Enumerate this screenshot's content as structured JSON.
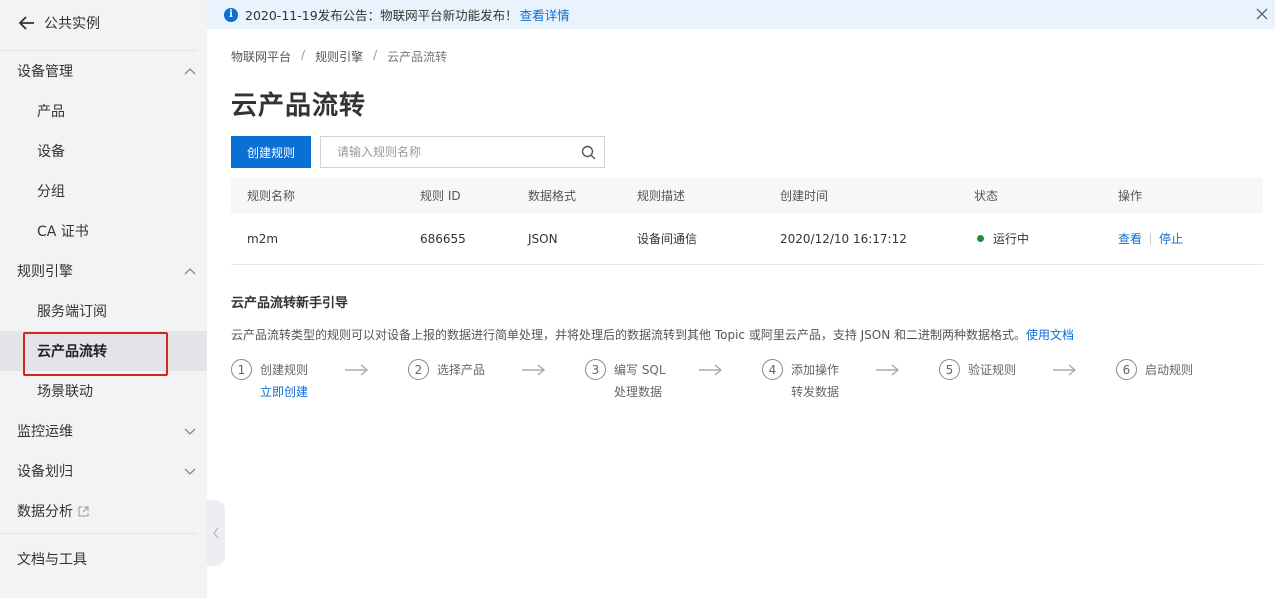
{
  "sidebar": {
    "back_label": "公共实例",
    "groups": [
      {
        "label": "设备管理",
        "expanded": true,
        "items": [
          "产品",
          "设备",
          "分组",
          "CA 证书"
        ]
      },
      {
        "label": "规则引擎",
        "expanded": true,
        "items": [
          "服务端订阅",
          "云产品流转",
          "场景联动"
        ]
      },
      {
        "label": "监控运维",
        "expanded": false
      },
      {
        "label": "设备划归",
        "expanded": false
      },
      {
        "label": "数据分析"
      }
    ],
    "bottom_label": "文档与工具",
    "active_item": "云产品流转"
  },
  "notice": {
    "text": "2020-11-19发布公告：物联网平台新功能发布！",
    "link": "查看详情"
  },
  "breadcrumb": [
    "物联网平台",
    "规则引擎",
    "云产品流转"
  ],
  "page_title": "云产品流转",
  "toolbar": {
    "create_label": "创建规则",
    "search_placeholder": "请输入规则名称"
  },
  "table": {
    "columns": [
      "规则名称",
      "规则 ID",
      "数据格式",
      "规则描述",
      "创建时间",
      "状态",
      "操作"
    ],
    "rows": [
      {
        "name": "m2m",
        "id": "686655",
        "format": "JSON",
        "description": "设备间通信",
        "created": "2020/12/10 16:17:12",
        "status": "运行中",
        "actions": [
          "查看",
          "停止"
        ]
      }
    ]
  },
  "guide": {
    "title": "云产品流转新手引导",
    "description": "云产品流转类型的规则可以对设备上报的数据进行简单处理，并将处理后的数据流转到其他 Topic 或阿里云产品，支持 JSON 和二进制两种数据格式。",
    "doc_link": "使用文档",
    "steps": [
      {
        "num": "1",
        "label": "创建规则",
        "sub": "立即创建",
        "sub_is_link": true
      },
      {
        "num": "2",
        "label": "选择产品"
      },
      {
        "num": "3",
        "label": "编写 SQL",
        "sub": "处理数据"
      },
      {
        "num": "4",
        "label": "添加操作",
        "sub": "转发数据"
      },
      {
        "num": "5",
        "label": "验证规则"
      },
      {
        "num": "6",
        "label": "启动规则"
      }
    ]
  },
  "colors": {
    "primary": "#0b6fd6",
    "running": "#1e8e3e",
    "highlight_border": "#e02020",
    "sidebar_bg": "#f2f3f5",
    "notice_bg": "#e8f3fd"
  }
}
